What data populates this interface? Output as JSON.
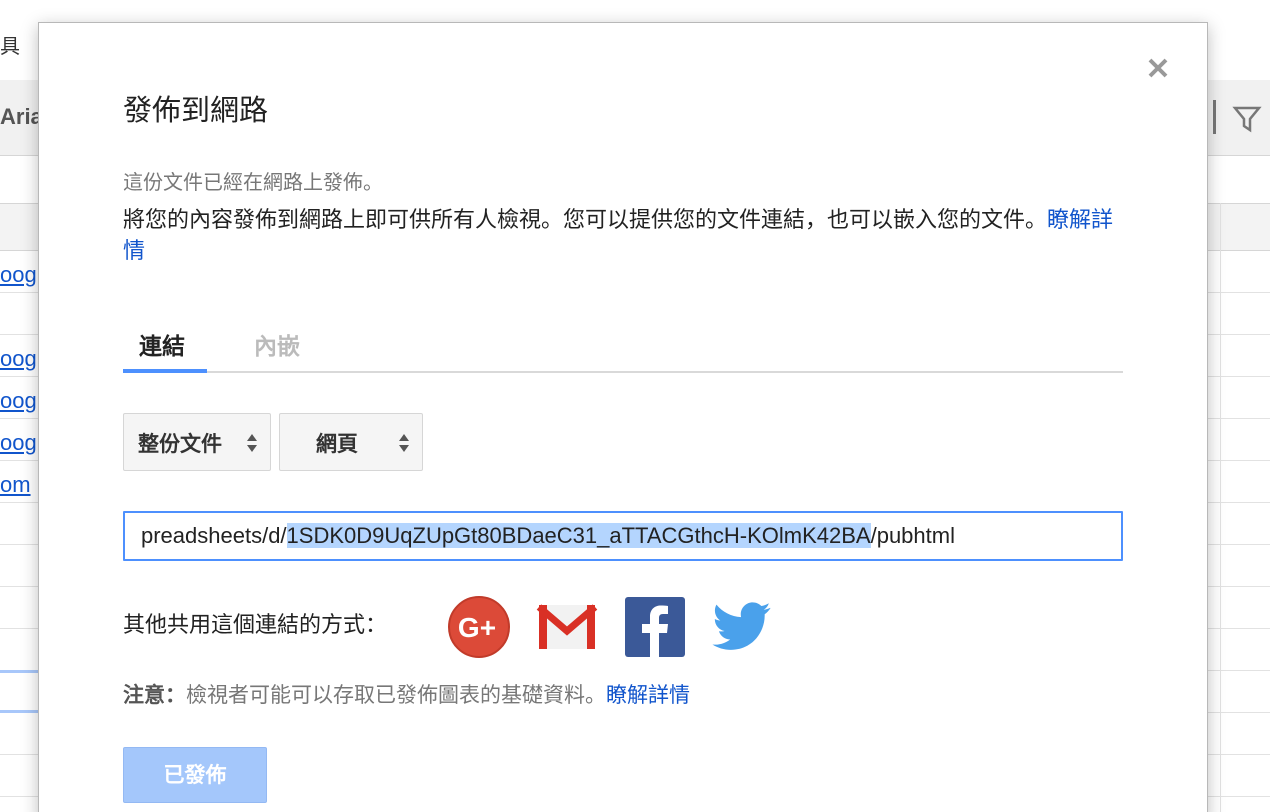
{
  "background": {
    "menu_text": "具",
    "font_name": "Aria",
    "links": [
      "oog",
      "oog",
      "oog",
      "oog",
      "om"
    ]
  },
  "dialog": {
    "title": "發佈到網路",
    "status": "這份文件已經在網路上發佈。",
    "description": "將您的內容發佈到網路上即可供所有人檢視。您可以提供您的文件連結，也可以嵌入您的文件。",
    "learn_more": "瞭解詳情",
    "tabs": [
      {
        "label": "連結",
        "active": true
      },
      {
        "label": "內嵌",
        "active": false
      }
    ],
    "scope_select": {
      "value": "整份文件"
    },
    "format_select": {
      "value": "網頁"
    },
    "url": {
      "before": "preadsheets/d/",
      "highlighted": "1SDK0D9UqZUpGt80BDaeC31_aTTACGthcH-KOlmK42BA",
      "after": "/pubhtml"
    },
    "share_label": "其他共用這個連結的方式：",
    "share_icons": [
      "google-plus-icon",
      "gmail-icon",
      "facebook-icon",
      "twitter-icon"
    ],
    "note_label": "注意：",
    "note_text": "檢視者可能可以存取已發佈圖表的基礎資料。",
    "note_learn_more": "瞭解詳情",
    "publish_button": "已發佈"
  },
  "colors": {
    "accent": "#4d90fe",
    "link": "#1155cc",
    "button_disabled": "#a4c7fb"
  }
}
